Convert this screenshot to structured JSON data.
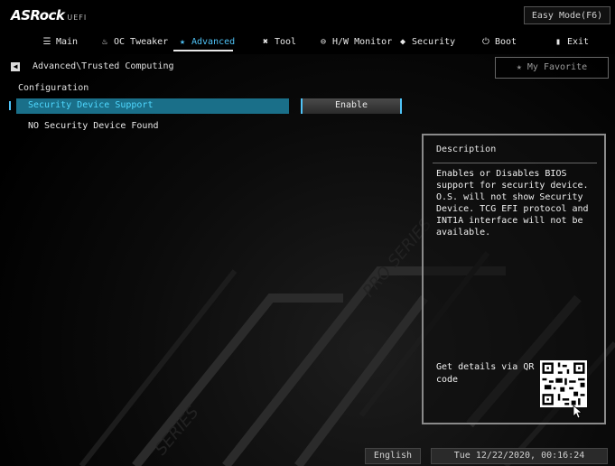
{
  "brand": {
    "logo": "ASRock",
    "suffix": "UEFI"
  },
  "mode_button": "Easy Mode(F6)",
  "tabs": [
    {
      "label": "Main",
      "icon": "menu-icon"
    },
    {
      "label": "OC Tweaker",
      "icon": "flame-icon"
    },
    {
      "label": "Advanced",
      "icon": "star-icon",
      "active": true
    },
    {
      "label": "Tool",
      "icon": "tools-icon"
    },
    {
      "label": "H/W Monitor",
      "icon": "monitor-icon"
    },
    {
      "label": "Security",
      "icon": "shield-icon"
    },
    {
      "label": "Boot",
      "icon": "power-icon"
    },
    {
      "label": "Exit",
      "icon": "exit-icon"
    }
  ],
  "breadcrumb": "Advanced\\Trusted Computing",
  "favorite": "My Favorite",
  "section": "Configuration",
  "items": [
    {
      "label": "Security Device Support",
      "value": "Enable",
      "selected": true
    },
    {
      "label": "NO Security Device Found"
    }
  ],
  "description": {
    "title": "Description",
    "body": "Enables or Disables BIOS support for security device. O.S. will not show Security Device. TCG EFI protocol and INT1A interface will not be available.",
    "qr_text": "Get details via QR code"
  },
  "status": {
    "language": "English",
    "datetime": "Tue 12/22/2020, 00:16:24"
  },
  "colors": {
    "accent": "#4fc3f7",
    "selected_row": "#1a6f89",
    "background": "#000000"
  }
}
